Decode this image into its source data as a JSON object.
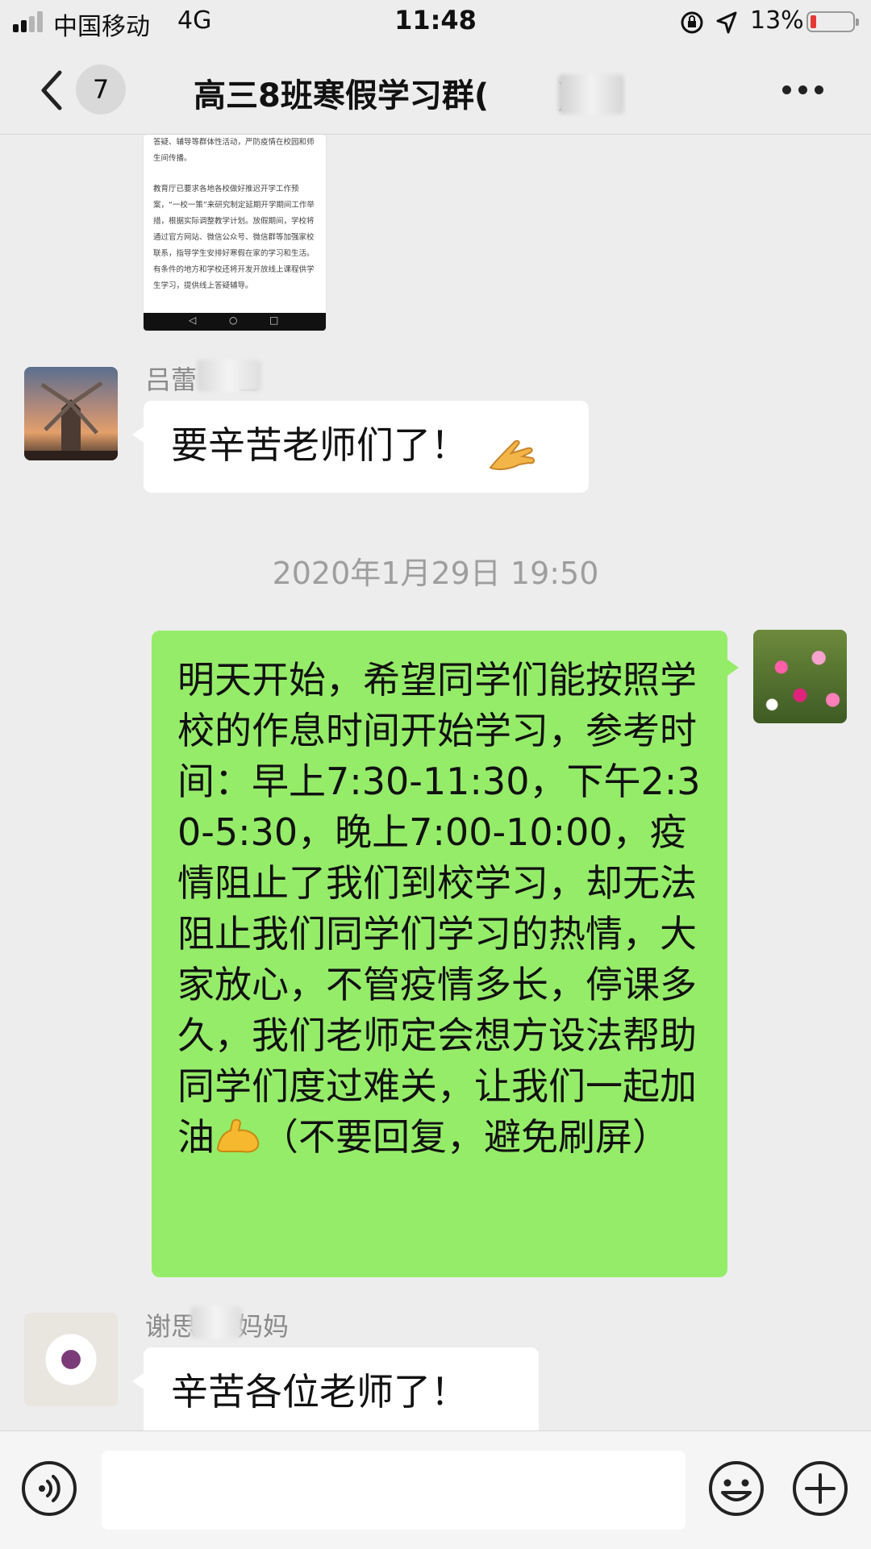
{
  "status_bar": {
    "carrier": "中国移动",
    "network": "4G",
    "time": "11:48",
    "battery_percent_label": "13%",
    "battery_level": 0.13,
    "icons": [
      "signal-icon",
      "orientation-lock-icon",
      "location-icon",
      "battery-icon"
    ]
  },
  "nav": {
    "unread_count": "7",
    "title": "高三8班寒假学习群(",
    "title_suffix": ")",
    "icons": [
      "back-icon",
      "more-icon"
    ]
  },
  "image_message": {
    "para1": "答疑、辅导等群体性活动，严防疫情在校园和师生间传播。",
    "para2": "教育厅已要求各地各校做好推迟开学工作预案，“一校一策”来研究制定延期开学期间工作举措，根据实际调整教学计划。放假期间，学校将通过官方网站、微信公众号、微信群等加强家校联系，指导学生安排好寒假在家的学习和生活。有条件的地方和学校还将开发开放线上课程供学生学习，提供线上答疑辅导。"
  },
  "messages": [
    {
      "sender": "吕蕾",
      "sender_suffix": "爸",
      "text": "要辛苦老师们了！",
      "emoji": "hands-emoji"
    },
    {
      "timestamp": "2020年1月29日 19:50"
    },
    {
      "sender": "me",
      "text_part1": "明天开始，希望同学们能按照学校的作息时间开始学习，参考时间：早上7:30-11:30，下午2:30-5:30，晚上7:00-10:00，疫情阻止了我们到校学习，却无法阻止我们同学们学习的热情，大家放心，不管疫情多长，停课多久，我们老师定会想方设法帮助同学们度过难关，让我们一起加油",
      "emoji": "flexed-biceps-emoji",
      "text_part2": "（不要回复，避免刷屏）"
    },
    {
      "sender": "谢思",
      "sender_suffix": "妈妈",
      "text": "辛苦各位老师了！"
    }
  ],
  "input_bar": {
    "placeholder": "",
    "icons": [
      "voice-icon",
      "emoji-icon",
      "plus-icon"
    ]
  },
  "colors": {
    "background": "#ededed",
    "green_bubble": "#95ec69",
    "white_bubble": "#ffffff",
    "timestamp_text": "#9e9e9e",
    "battery_low": "#e53935"
  }
}
